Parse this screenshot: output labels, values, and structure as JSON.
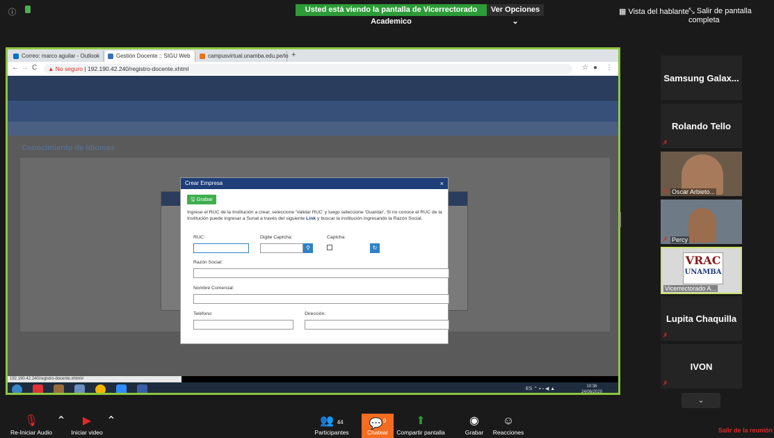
{
  "zoom": {
    "viewing_banner": "Usted está viendo la pantalla de Vicerrectorado Academico",
    "view_options": "Ver Opciones ⌄",
    "speaker_view": "Vista del hablante",
    "exit_fullscreen": "Salir de pantalla completa",
    "bottom": {
      "audio": "Re-Iniciar Audio",
      "video": "Iniciar video",
      "participants": "Participantes",
      "participants_count": "44",
      "chat": "Chatear",
      "chat_badge": "9",
      "share": "Compartir pantalla",
      "record": "Grabar",
      "reactions": "Reacciones",
      "leave": "Salir de la reunión"
    },
    "participants": [
      {
        "name": "Samsung Galax...",
        "muted": false
      },
      {
        "name": "Rolando Tello",
        "muted": true
      },
      {
        "name": "Oscar Arbieto...",
        "muted": true,
        "video": true
      },
      {
        "name": "Percy",
        "muted": true,
        "video": true
      },
      {
        "name": "Vicerrectorado A...",
        "muted": false,
        "logo_line1": "VRAC",
        "logo_line2": "UNAMBA"
      },
      {
        "name": "Lupita Chaquilla",
        "muted": true
      },
      {
        "name": "IVON",
        "muted": true
      }
    ]
  },
  "browser": {
    "tabs": [
      "Correo: marco aguilar - Outlook",
      "Gestión Docente :: SIGU Web",
      "campusvirtual.unamba.edu.pe/lo"
    ],
    "url_warning": "No seguro",
    "url": "192.190.42.240/registro-docente.xhtml",
    "status_url": "192.190.42.240/registro-docente.xhtml#"
  },
  "page": {
    "section_title": "Conocimiento de Idiomas"
  },
  "dialog": {
    "title": "Crear Empresa",
    "close": "×",
    "save_label": "Grabar",
    "info_part1": "Ingrese el RUC de la Institución a crear, seleccione 'Validar RUC' y luego seleccione 'Guardar', Si no conoce el RUC de la Institución puede ingresar a Sunat a través del siguiente ",
    "info_link": "Link",
    "info_part2": " y buscar la institución ingresando la Razón Social.",
    "ruc_label": "RUC:",
    "captcha_digit_label": "Digite Captcha:",
    "captcha_label": "Captcha:",
    "razon_label": "Razón Social:",
    "nombre_label": "Nombre Comercial:",
    "telefono_label": "Teléfono:",
    "direccion_label": "Dirección:"
  },
  "taskbar": {
    "tray": "ES",
    "time": "10:36",
    "date": "24/06/2020"
  }
}
